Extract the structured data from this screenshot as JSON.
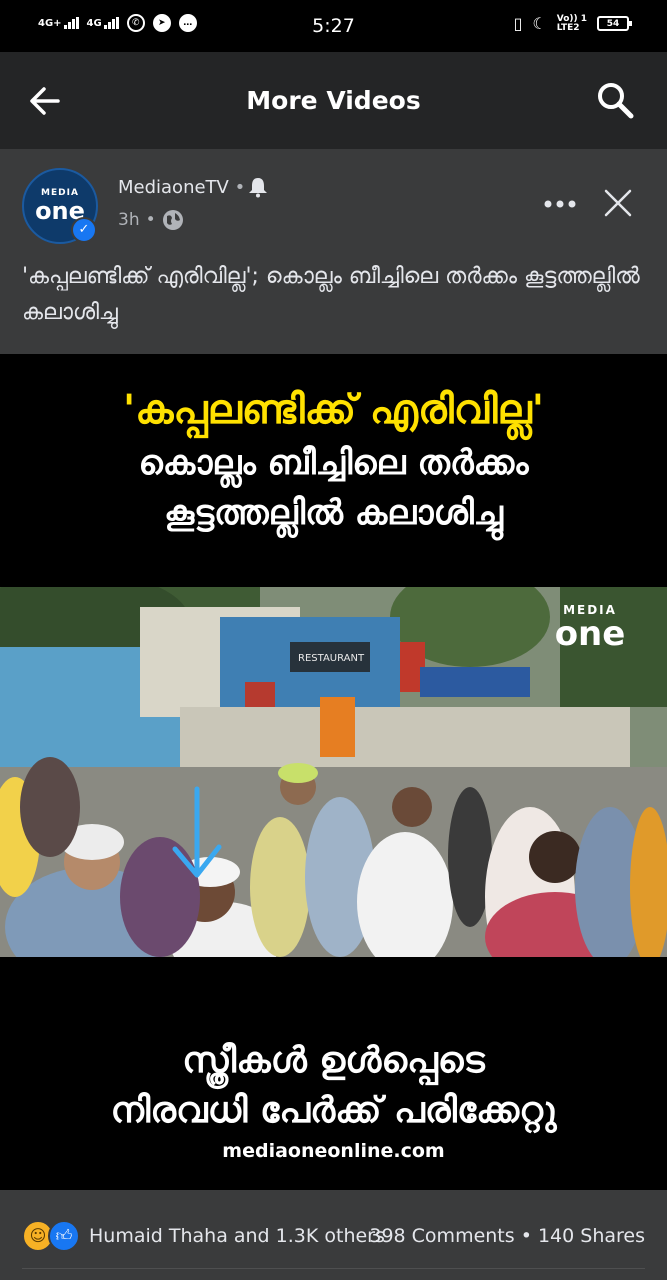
{
  "status_bar": {
    "net1": "4G+",
    "net2": "4G",
    "time": "5:27",
    "volte_top": "Vo)) 1",
    "volte_bottom": "LTE2",
    "battery": "54"
  },
  "header": {
    "title": "More Videos"
  },
  "post": {
    "page_name": "MediaoneTV",
    "time_ago": "3h",
    "caption": "'കപ്പലണ്ടിക്ക് എരിവില്ല'; കൊല്ലം ബീച്ചിലെ തർക്കം കൂട്ടത്തല്ലിൽ കലാശിച്ചു",
    "avatar_top": "MEDIA",
    "avatar_bottom": "one"
  },
  "video": {
    "headline": "'കപ്പലണ്ടിക്ക് എരിവില്ല'",
    "subline1": "കൊല്ലം ബീച്ചിലെ തർക്കം",
    "subline2": "കൂട്ടത്തല്ലിൽ കലാശിച്ചു",
    "logo_top": "MEDIA",
    "logo_bottom": "one",
    "bottom1": "സ്ത്രീകൾ ഉൾപ്പെടെ",
    "bottom2": "നിരവധി പേർക്ക് പരിക്കേറ്റു",
    "site": "mediaoneonline.com",
    "shop_sign": "RESTAURANT"
  },
  "footer": {
    "reacted_by": "Humaid Thaha and 1.3K others",
    "comments": "398 Comments",
    "shares": "140 Shares"
  },
  "colors": {
    "accent": "#1877f2",
    "headline_yellow": "#ffe100",
    "arrow": "#3aa8f0"
  }
}
